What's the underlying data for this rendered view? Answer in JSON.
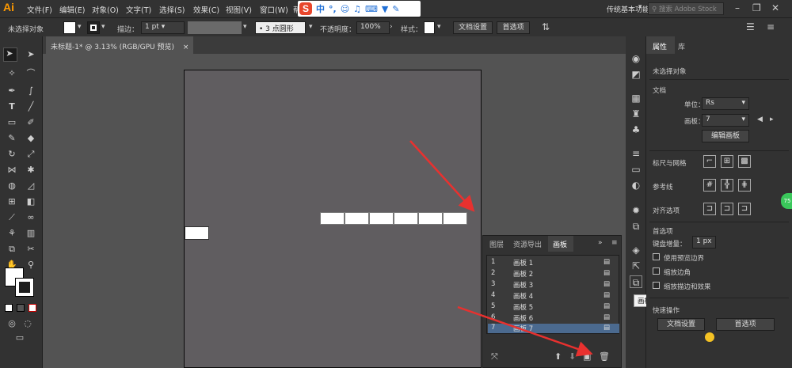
{
  "app": {
    "logo": "Ai"
  },
  "menu": [
    "文件(F)",
    "编辑(E)",
    "对象(O)",
    "文字(T)",
    "选择(S)",
    "效果(C)",
    "视图(V)",
    "窗口(W)",
    "帮"
  ],
  "ime": {
    "logo": "S",
    "lang": "中"
  },
  "workspace": "传统基本功能",
  "search_placeholder": "搜索 Adobe Stock",
  "control": {
    "no_selection": "未选择对象",
    "stroke_label": "描边：",
    "stroke_value": "1 pt",
    "brush": "3 点圆形",
    "opacity_label": "不透明度：",
    "opacity_value": "100%",
    "style_label": "样式：",
    "doc_setup": "文档设置",
    "prefs": "首选项"
  },
  "document_tab": "未标题-1* @ 3.13% (RGB/GPU 预览)",
  "close_glyph": "×",
  "layers_panel": {
    "tabs": [
      "图层",
      "资源导出",
      "画板"
    ],
    "rows": [
      {
        "num": "1",
        "name": "画板 1"
      },
      {
        "num": "2",
        "name": "画板 2"
      },
      {
        "num": "3",
        "name": "画板 3"
      },
      {
        "num": "4",
        "name": "画板 4"
      },
      {
        "num": "5",
        "name": "画板 5"
      },
      {
        "num": "6",
        "name": "画板 6"
      },
      {
        "num": "7",
        "name": "画板 7"
      }
    ],
    "selected_row": 7
  },
  "tooltip": "画板",
  "properties": {
    "tabs": [
      "属性",
      "库"
    ],
    "no_selection": "未选择对象",
    "document_heading": "文档",
    "unit_label": "单位：",
    "unit_value": "Rs",
    "artboard_label": "画板：",
    "artboard_value": "7",
    "edit_artboard": "编辑画板",
    "rulers_grids": "标尺与网格",
    "guides": "参考线",
    "align_options": "对齐选项",
    "prefs_heading": "首选项",
    "keyboard_increment_label": "键盘增量：",
    "keyboard_increment_value": "1 px",
    "check_preview": "使用预览边界",
    "check_corners": "缩放边角",
    "check_strokes": "缩放描边和效果",
    "quick_actions": "快速操作",
    "doc_setup": "文档设置",
    "prefs": "首选项"
  },
  "side_badge": "75",
  "colors": {
    "accent_arrow": "#e8312f",
    "selected_row": "#4b6a8f",
    "ime_logo": "#e8462c"
  }
}
